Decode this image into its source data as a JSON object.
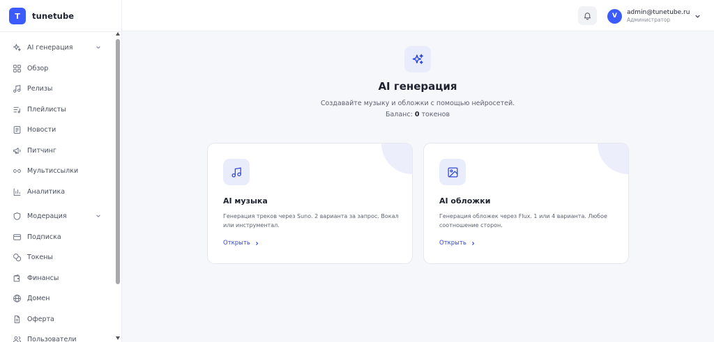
{
  "brand": {
    "logo_letter": "T",
    "name": "tunetube"
  },
  "sidebar": {
    "items": [
      {
        "label": "AI генерация",
        "icon": "sparkles-icon",
        "expandable": true
      },
      {
        "label": "Обзор",
        "icon": "grid-icon"
      },
      {
        "label": "Релизы",
        "icon": "music-note-icon"
      },
      {
        "label": "Плейлисты",
        "icon": "playlist-icon"
      },
      {
        "label": "Новости",
        "icon": "newspaper-icon"
      },
      {
        "label": "Питчинг",
        "icon": "megaphone-icon"
      },
      {
        "label": "Мультиссылки",
        "icon": "link-icon"
      },
      {
        "label": "Аналитика",
        "icon": "bar-chart-icon"
      },
      {
        "label": "Модерация",
        "icon": "shield-icon",
        "expandable": true
      },
      {
        "label": "Подписка",
        "icon": "credit-card-icon"
      },
      {
        "label": "Токены",
        "icon": "coins-icon"
      },
      {
        "label": "Финансы",
        "icon": "wallet-icon"
      },
      {
        "label": "Домен",
        "icon": "globe-icon"
      },
      {
        "label": "Оферта",
        "icon": "document-icon"
      },
      {
        "label": "Пользователи",
        "icon": "users-icon"
      }
    ]
  },
  "header": {
    "notifications_icon": "bell-icon",
    "user": {
      "avatar_letter": "V",
      "email": "admin@tunetube.ru",
      "role": "Администратор"
    }
  },
  "main": {
    "icon": "sparkles-icon",
    "title": "AI генерация",
    "subtitle": "Создавайте музыку и обложки с помощью нейросетей.",
    "balance_prefix": "Баланс:",
    "balance_value": "0",
    "balance_suffix": "токенов",
    "cards": [
      {
        "icon": "music-note-icon",
        "title": "AI музыка",
        "description": "Генерация треков через Suno. 2 варианта за запрос. Вокал или инструментал.",
        "link": "Открыть"
      },
      {
        "icon": "image-icon",
        "title": "AI обложки",
        "description": "Генерация обложек через Flux. 1 или 4 варианта. Любое соотношение сторон.",
        "link": "Открыть"
      }
    ]
  },
  "colors": {
    "accent": "#3b5bff",
    "link": "#2f47d8",
    "background": "#f6f7fb",
    "icon_tile": "#e9ecfb"
  }
}
